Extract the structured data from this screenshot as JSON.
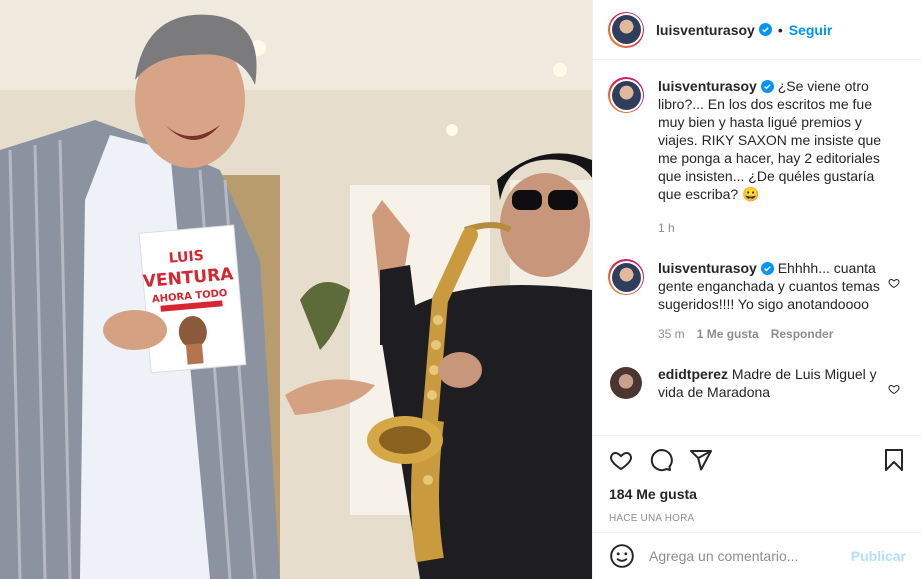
{
  "post": {
    "username": "luisventurasoy",
    "follow_label": "Seguir",
    "dot": "•",
    "book": {
      "title_line1": "LUIS",
      "title_line2": "VENTURA",
      "subtitle": "AHORA TODO"
    }
  },
  "caption": {
    "username": "luisventurasoy",
    "text": "¿Se viene otro libro?... En los dos escritos me fue muy bien y hasta ligué premios y viajes. RIKY SAXON me insiste que me ponga a hacer, hay 2 editoriales que insisten... ¿De quéles gustaría que escriba? 😀",
    "time": "1 h"
  },
  "comments": [
    {
      "username": "luisventurasoy",
      "text": "Ehhhh... cuanta gente enganchada y cuantos temas sugeridos!!!! Yo sigo anotandoooo",
      "time": "35 m",
      "likes": "1 Me gusta",
      "reply": "Responder"
    },
    {
      "username": "edidtperez",
      "text": "Madre de Luis Miguel y vida de Maradona"
    }
  ],
  "actions": {
    "likes": "184 Me gusta",
    "posted": "HACE UNA HORA"
  },
  "add_comment": {
    "placeholder": "Agrega un comentario...",
    "publish": "Publicar"
  },
  "colors": {
    "accent": "#0095f6",
    "publish_disabled": "#b2dffc",
    "muted": "#8e8e8e"
  }
}
